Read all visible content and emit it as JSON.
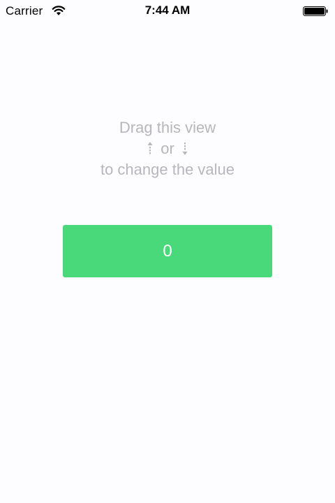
{
  "status_bar": {
    "carrier": "Carrier",
    "time": "7:44 AM",
    "icons": [
      "wifi-icon",
      "battery-icon"
    ]
  },
  "instructions": {
    "line1": "Drag this view",
    "connector": "or",
    "line3": "to change the value",
    "icons": [
      "arrow-up-icon",
      "arrow-down-icon"
    ]
  },
  "stepper": {
    "value": "0"
  },
  "colors": {
    "background": "#fdfcfe",
    "accent": "#4ad97a",
    "instruction_text": "#b7b7bb",
    "value_text": "#ffffff"
  }
}
